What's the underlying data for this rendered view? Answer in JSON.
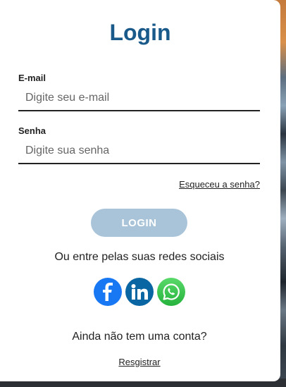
{
  "form": {
    "title": "Login",
    "email": {
      "label": "E-mail",
      "value": "",
      "placeholder": "Digite seu e-mail"
    },
    "password": {
      "label": "Senha",
      "value": "",
      "placeholder": "Digite sua senha"
    },
    "forgot_label": "Esqueceu a senha?",
    "login_label": "LOGIN",
    "social_prompt": "Ou entre pelas suas redes sociais",
    "social": [
      {
        "icon": "facebook-icon",
        "color": "#1877f2"
      },
      {
        "icon": "linkedin-icon",
        "color": "#0a66a2"
      },
      {
        "icon": "whatsapp-icon",
        "color": "#25d366"
      }
    ],
    "no_account_text": "Ainda não tem uma conta?",
    "register_label": "Resgistrar"
  },
  "colors": {
    "title": "#1a5a8a",
    "login_button": "#a9c4d8"
  }
}
